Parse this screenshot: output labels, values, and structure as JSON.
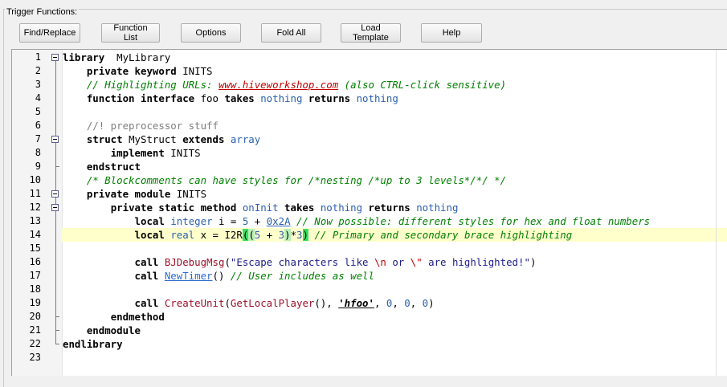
{
  "group_title": "Trigger Functions:",
  "toolbar": [
    {
      "label": "Find/Replace"
    },
    {
      "label": "Function List"
    },
    {
      "label": "Options"
    },
    {
      "label": "Fold All"
    },
    {
      "label": "Load Template"
    },
    {
      "label": "Help"
    }
  ],
  "editor": {
    "current_line": 14,
    "lines": [
      {
        "n": "1",
        "tokens": [
          [
            "kw",
            "library"
          ],
          [
            "",
            "  MyLibrary"
          ]
        ]
      },
      {
        "n": "2",
        "tokens": [
          [
            "",
            "    "
          ],
          [
            "kw",
            "private keyword"
          ],
          [
            "",
            " INITS"
          ]
        ]
      },
      {
        "n": "3",
        "tokens": [
          [
            "",
            "    "
          ],
          [
            "cmt",
            "// Highlighting URLs: "
          ],
          [
            "url",
            "www.hiveworkshop.com"
          ],
          [
            "cmt",
            " (also CTRL-click sensitive)"
          ]
        ]
      },
      {
        "n": "4",
        "tokens": [
          [
            "",
            "    "
          ],
          [
            "kw",
            "function interface"
          ],
          [
            "",
            " foo "
          ],
          [
            "kw",
            "takes"
          ],
          [
            "",
            " "
          ],
          [
            "type",
            "nothing"
          ],
          [
            "",
            " "
          ],
          [
            "kw",
            "returns"
          ],
          [
            "",
            " "
          ],
          [
            "type",
            "nothing"
          ]
        ]
      },
      {
        "n": "5",
        "tokens": []
      },
      {
        "n": "6",
        "tokens": [
          [
            "",
            "    "
          ],
          [
            "prep",
            "//! preprocessor stuff"
          ]
        ]
      },
      {
        "n": "7",
        "tokens": [
          [
            "",
            "    "
          ],
          [
            "kw",
            "struct"
          ],
          [
            "",
            " MyStruct "
          ],
          [
            "kw",
            "extends"
          ],
          [
            "",
            " "
          ],
          [
            "type",
            "array"
          ]
        ]
      },
      {
        "n": "8",
        "tokens": [
          [
            "",
            "        "
          ],
          [
            "kw",
            "implement"
          ],
          [
            "",
            " INITS"
          ]
        ]
      },
      {
        "n": "9",
        "tokens": [
          [
            "",
            "    "
          ],
          [
            "kw",
            "endstruct"
          ]
        ]
      },
      {
        "n": "10",
        "tokens": [
          [
            "",
            "    "
          ],
          [
            "cmt",
            "/* Blockcomments can have styles for /*nesting /*up to 3 levels*/*/ */"
          ]
        ]
      },
      {
        "n": "11",
        "tokens": [
          [
            "",
            "    "
          ],
          [
            "kw",
            "private module"
          ],
          [
            "",
            " INITS"
          ]
        ]
      },
      {
        "n": "12",
        "tokens": [
          [
            "",
            "        "
          ],
          [
            "kw",
            "private static method"
          ],
          [
            "",
            " "
          ],
          [
            "type",
            "onInit"
          ],
          [
            "",
            " "
          ],
          [
            "kw",
            "takes"
          ],
          [
            "",
            " "
          ],
          [
            "type",
            "nothing"
          ],
          [
            "",
            " "
          ],
          [
            "kw",
            "returns"
          ],
          [
            "",
            " "
          ],
          [
            "type",
            "nothing"
          ]
        ]
      },
      {
        "n": "13",
        "tokens": [
          [
            "",
            "            "
          ],
          [
            "kw",
            "local"
          ],
          [
            "",
            " "
          ],
          [
            "type",
            "integer"
          ],
          [
            "",
            " i = "
          ],
          [
            "num",
            "5"
          ],
          [
            "",
            " + "
          ],
          [
            "hex",
            "0x2A"
          ],
          [
            "",
            " "
          ],
          [
            "cmt",
            "// Now possible: different styles for hex and float numbers"
          ]
        ]
      },
      {
        "n": "14",
        "tokens": [
          [
            "",
            "            "
          ],
          [
            "kw",
            "local"
          ],
          [
            "",
            " "
          ],
          [
            "type",
            "real"
          ],
          [
            "",
            " x = I2R"
          ],
          [
            "brace1",
            "("
          ],
          [
            "brace2",
            "("
          ],
          [
            "num",
            "5"
          ],
          [
            "",
            " + "
          ],
          [
            "num",
            "3"
          ],
          [
            "brace2",
            ")"
          ],
          [
            "",
            "*"
          ],
          [
            "num",
            "3"
          ],
          [
            "brace1",
            ")"
          ],
          [
            "",
            " "
          ],
          [
            "cmt",
            "// Primary and secondary brace highlighting"
          ]
        ]
      },
      {
        "n": "15",
        "tokens": []
      },
      {
        "n": "16",
        "tokens": [
          [
            "",
            "            "
          ],
          [
            "kw",
            "call"
          ],
          [
            "",
            " "
          ],
          [
            "fn",
            "BJDebugMsg"
          ],
          [
            "",
            "("
          ],
          [
            "str",
            "\"Escape characters like "
          ],
          [
            "esc",
            "\\n"
          ],
          [
            "str",
            " or "
          ],
          [
            "esc",
            "\\\""
          ],
          [
            "str",
            " are highlighted!\""
          ],
          [
            "",
            ")"
          ]
        ]
      },
      {
        "n": "17",
        "tokens": [
          [
            "",
            "            "
          ],
          [
            "kw",
            "call"
          ],
          [
            "",
            " "
          ],
          [
            "fnu",
            "NewTimer"
          ],
          [
            "",
            "() "
          ],
          [
            "cmt",
            "// User includes as well"
          ]
        ]
      },
      {
        "n": "18",
        "tokens": []
      },
      {
        "n": "19",
        "tokens": [
          [
            "",
            "            "
          ],
          [
            "kw",
            "call"
          ],
          [
            "",
            " "
          ],
          [
            "fn",
            "CreateUnit"
          ],
          [
            "",
            "("
          ],
          [
            "fn",
            "GetLocalPlayer"
          ],
          [
            "",
            "(), "
          ],
          [
            "rawcode",
            "'hfoo'"
          ],
          [
            "",
            ", "
          ],
          [
            "num",
            "0"
          ],
          [
            "",
            ", "
          ],
          [
            "num",
            "0"
          ],
          [
            "",
            ", "
          ],
          [
            "num",
            "0"
          ],
          [
            "",
            ")"
          ]
        ]
      },
      {
        "n": "20",
        "tokens": [
          [
            "",
            "        "
          ],
          [
            "kw",
            "endmethod"
          ]
        ]
      },
      {
        "n": "21",
        "tokens": [
          [
            "",
            "    "
          ],
          [
            "kw",
            "endmodule"
          ]
        ]
      },
      {
        "n": "22",
        "tokens": [
          [
            "kw",
            "endlibrary"
          ]
        ]
      },
      {
        "n": "23",
        "tokens": []
      }
    ]
  }
}
